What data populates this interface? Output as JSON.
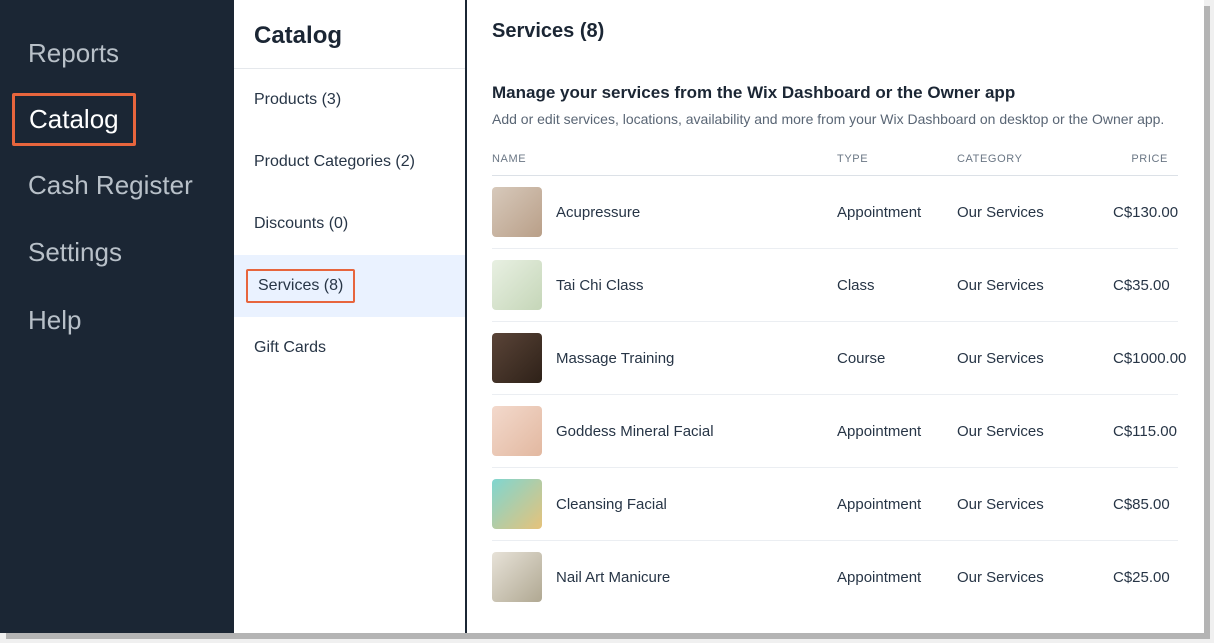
{
  "primary_nav": {
    "items": [
      {
        "label": "Reports",
        "active": false
      },
      {
        "label": "Catalog",
        "active": true
      },
      {
        "label": "Cash Register",
        "active": false
      },
      {
        "label": "Settings",
        "active": false
      },
      {
        "label": "Help",
        "active": false
      }
    ]
  },
  "secondary_nav": {
    "title": "Catalog",
    "items": [
      {
        "label": "Products (3)",
        "active": false
      },
      {
        "label": "Product Categories (2)",
        "active": false
      },
      {
        "label": "Discounts (0)",
        "active": false
      },
      {
        "label": "Services (8)",
        "active": true
      },
      {
        "label": "Gift Cards",
        "active": false
      }
    ]
  },
  "main": {
    "title": "Services (8)",
    "section_heading": "Manage your services from the Wix Dashboard or the Owner app",
    "section_sub": "Add or edit services, locations, availability and more from your Wix Dashboard on desktop or the Owner app.",
    "columns": {
      "name": "NAME",
      "type": "TYPE",
      "category": "CATEGORY",
      "price": "PRICE"
    },
    "rows": [
      {
        "name": "Acupressure",
        "type": "Appointment",
        "category": "Our Services",
        "price": "C$130.00"
      },
      {
        "name": "Tai Chi Class",
        "type": "Class",
        "category": "Our Services",
        "price": "C$35.00"
      },
      {
        "name": "Massage Training",
        "type": "Course",
        "category": "Our Services",
        "price": "C$1000.00"
      },
      {
        "name": "Goddess Mineral Facial",
        "type": "Appointment",
        "category": "Our Services",
        "price": "C$115.00"
      },
      {
        "name": "Cleansing Facial",
        "type": "Appointment",
        "category": "Our Services",
        "price": "C$85.00"
      },
      {
        "name": "Nail Art Manicure",
        "type": "Appointment",
        "category": "Our Services",
        "price": "C$25.00"
      }
    ]
  }
}
